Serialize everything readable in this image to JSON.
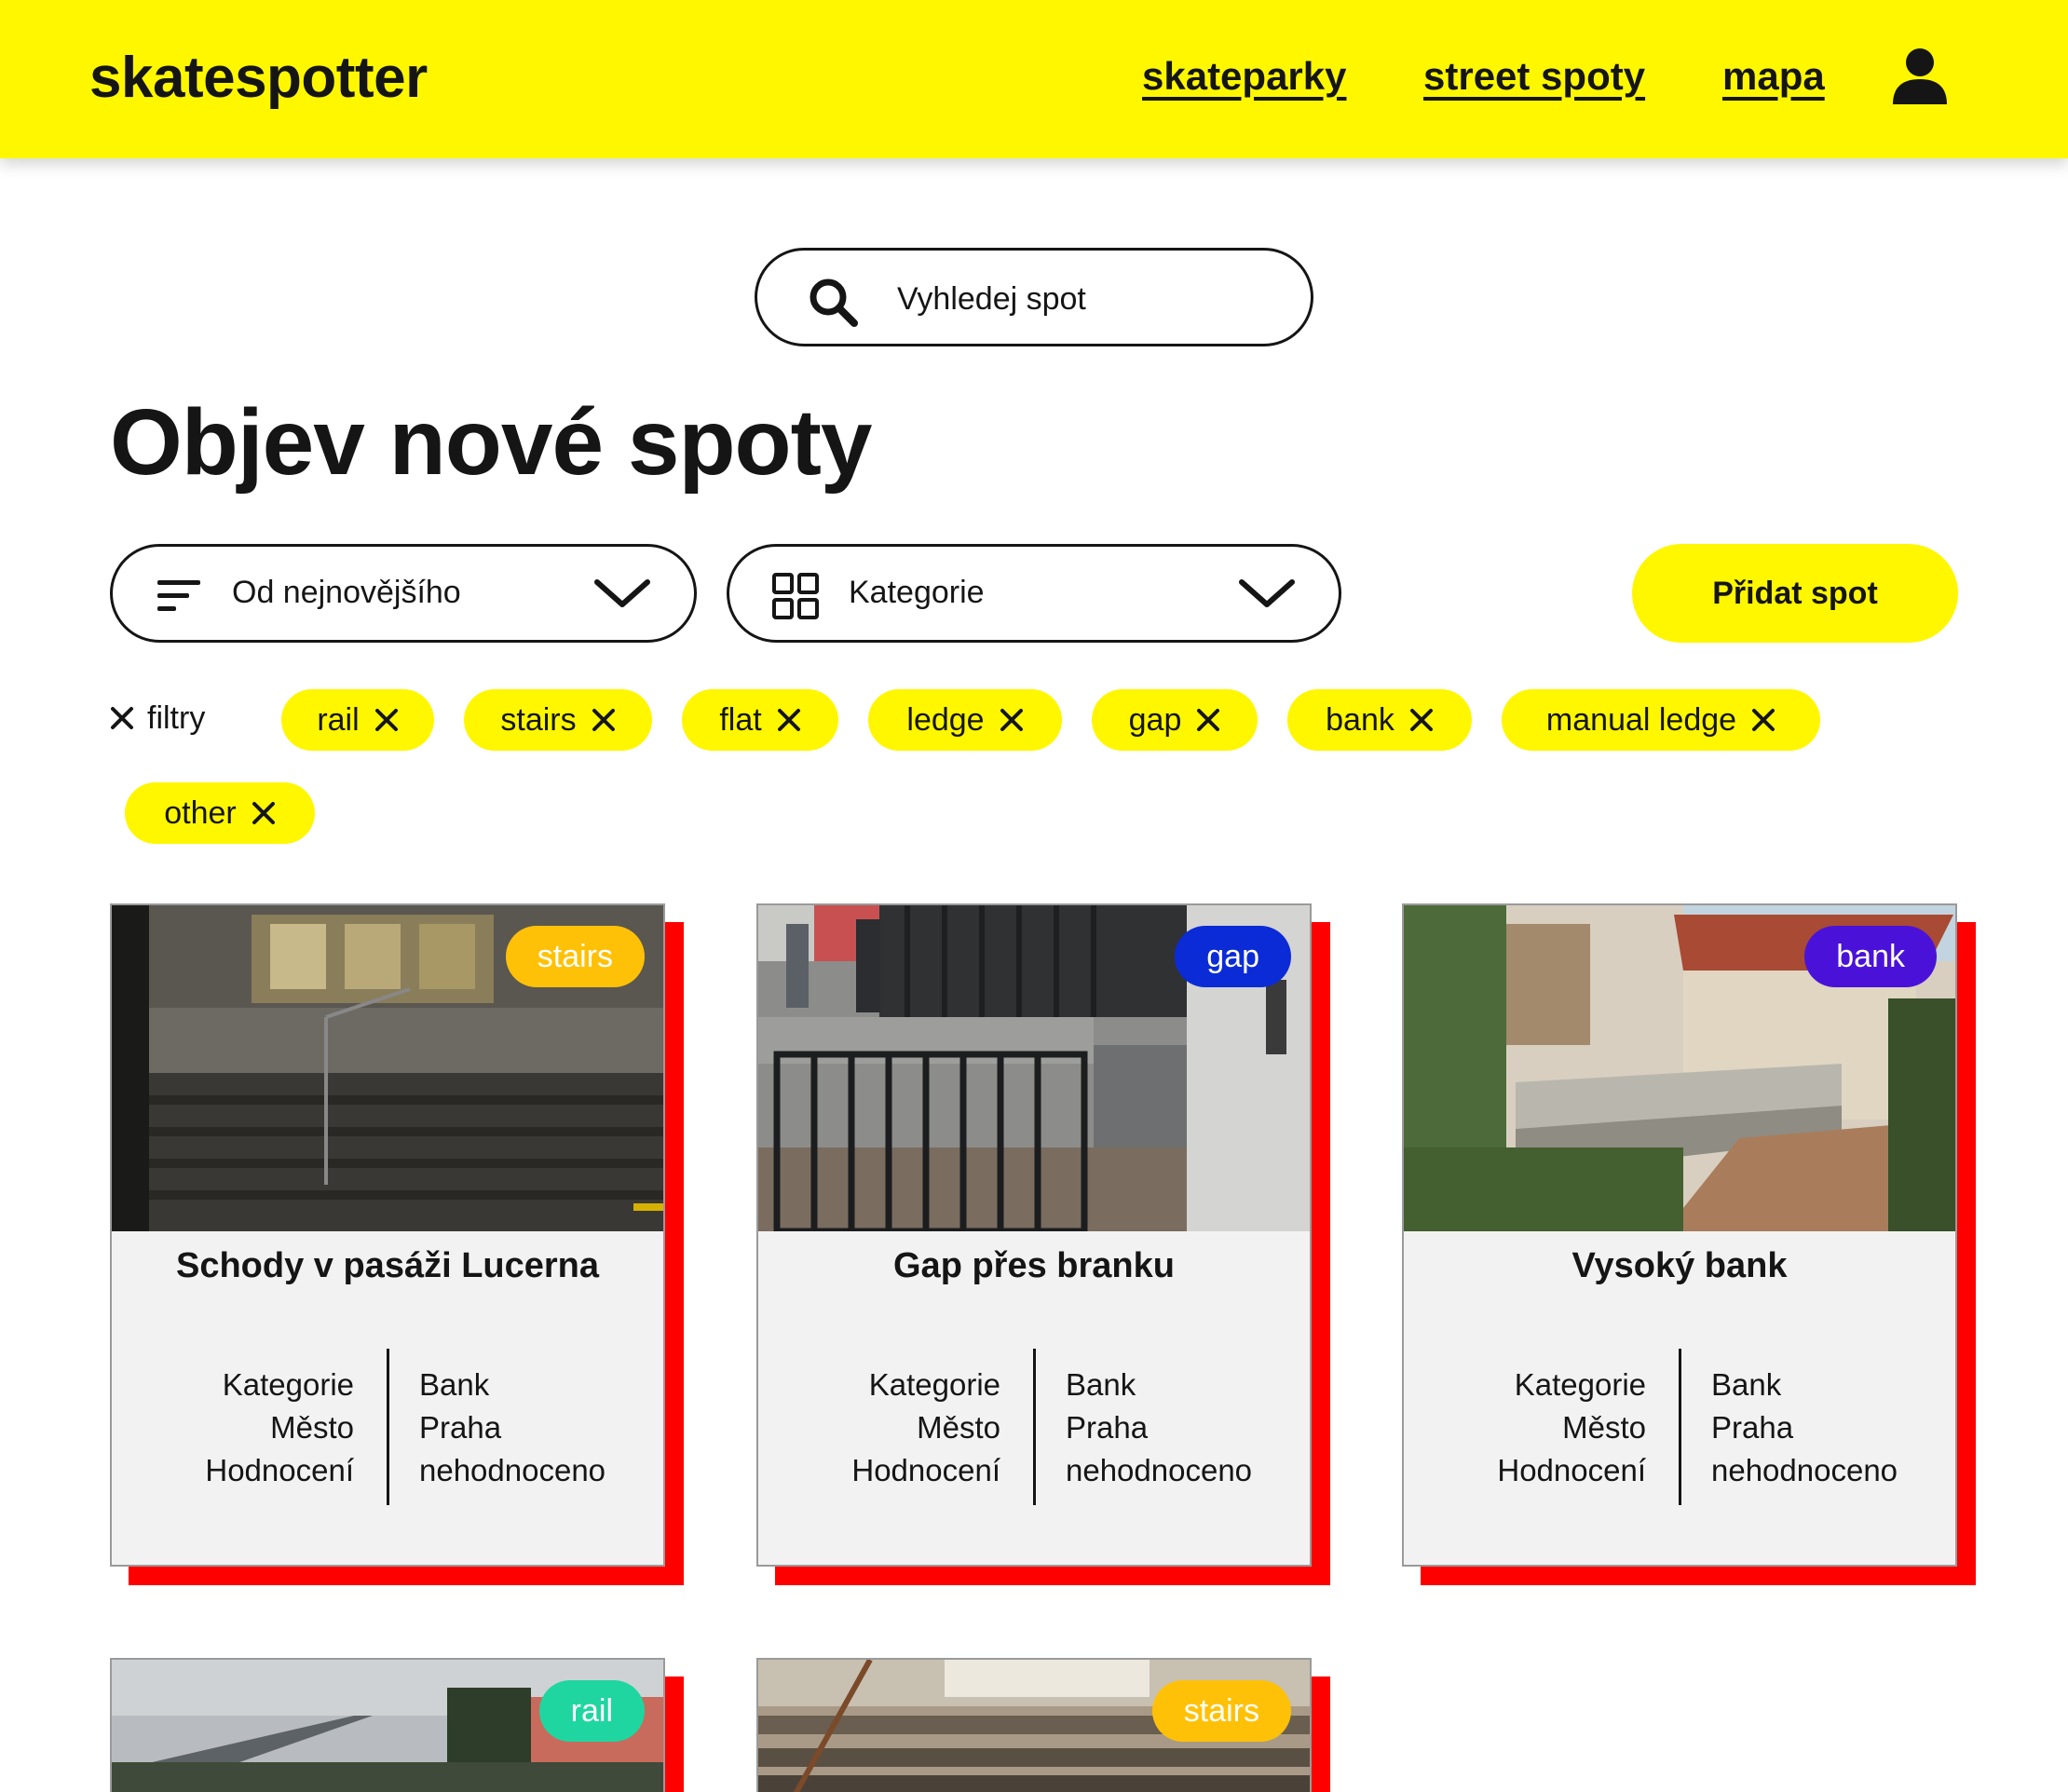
{
  "header": {
    "logo": "skatespotter",
    "nav": [
      {
        "label": "skateparky"
      },
      {
        "label": "street spoty"
      },
      {
        "label": "mapa"
      }
    ],
    "user_icon": "user-icon"
  },
  "search": {
    "placeholder": "Vyhledej spot",
    "icon": "search-icon"
  },
  "page_title": "Objev nové spoty",
  "sort_select": {
    "value": "Od nejnovějšího",
    "icon": "sort-icon"
  },
  "category_select": {
    "value": "Kategorie",
    "icon": "grid-icon"
  },
  "add_button": "Přidat spot",
  "filters": {
    "clear_label": "filtry",
    "chips": [
      "rail",
      "stairs",
      "flat",
      "ledge",
      "gap",
      "bank",
      "manual ledge",
      "other"
    ]
  },
  "card_labels": {
    "category": "Kategorie",
    "city": "Město",
    "rating": "Hodnocení"
  },
  "cards": [
    {
      "tag": "stairs",
      "tag_color": "#ffc107",
      "title": "Schody v pasáži Lucerna",
      "category": "Bank",
      "city": "Praha",
      "rating": "nehodnoceno"
    },
    {
      "tag": "gap",
      "tag_color": "#0b2bd6",
      "title": "Gap přes branku",
      "category": "Bank",
      "city": "Praha",
      "rating": "nehodnoceno"
    },
    {
      "tag": "bank",
      "tag_color": "#4a12d9",
      "title": "Vysoký bank",
      "category": "Bank",
      "city": "Praha",
      "rating": "nehodnoceno"
    },
    {
      "tag": "rail",
      "tag_color": "#1fd6a0",
      "title": "",
      "category": "",
      "city": "",
      "rating": ""
    },
    {
      "tag": "stairs",
      "tag_color": "#ffc107",
      "title": "",
      "category": "",
      "city": "",
      "rating": ""
    }
  ],
  "colors": {
    "brand_yellow": "#fff700",
    "card_shadow": "#ff0000",
    "text": "#151515"
  }
}
